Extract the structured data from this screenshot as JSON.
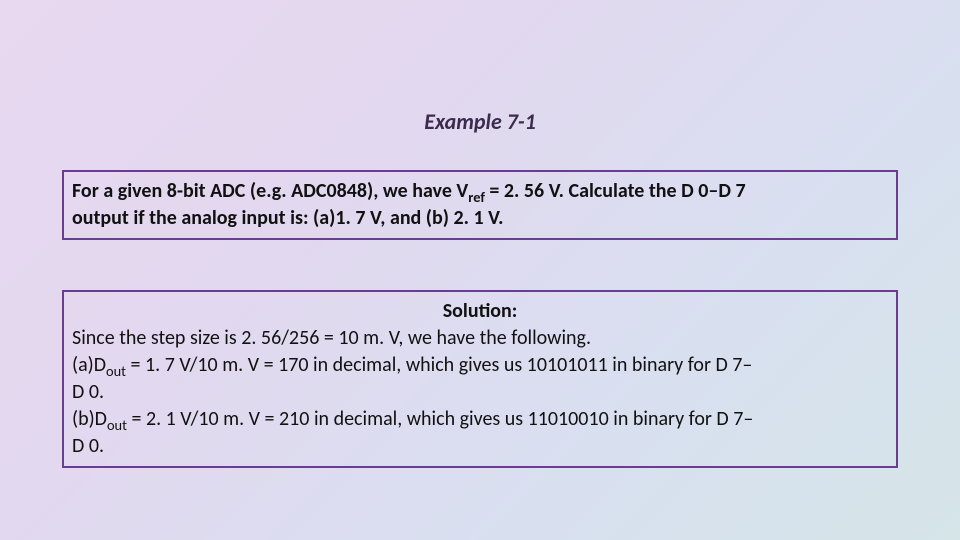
{
  "title": "Example 7-1",
  "problem": {
    "l1a": "For a given 8-bit ADC (e.g. ADC0848), we have V",
    "l1sub": "ref",
    "l1b": " = 2. 56 V. Calculate the D 0–D 7",
    "l2": "output if the analog input is: (a)1. 7 V, and (b) 2. 1 V."
  },
  "solution": {
    "heading": "Solution:",
    "l1": "Since the step size is 2. 56/256 = 10 m. V, we have the following.",
    "l2a": " (a)D",
    "l2sub": "out",
    "l2b": " = 1. 7 V/10 m. V = 170 in decimal, which gives us 10101011 in binary for D 7–",
    "l3": "D 0.",
    "l4a": " (b)D",
    "l4sub": "out",
    "l4b": " = 2. 1 V/10 m. V = 210 in decimal, which gives us 11010010 in binary for D 7–",
    "l5": "D 0."
  }
}
